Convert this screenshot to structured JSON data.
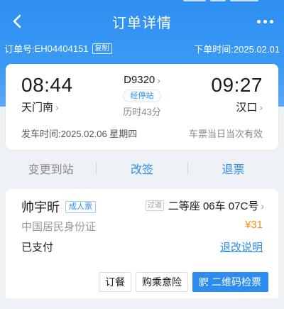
{
  "header": {
    "title": "订单详情",
    "back_icon": "chevron-left-icon",
    "more_icon": "more-dots-icon"
  },
  "order": {
    "order_no_label": "订单号:",
    "order_no": "EH04404151",
    "copy_label": "复制",
    "placed_time_label": "下单时间:",
    "placed_time": "2025.02.01"
  },
  "trip": {
    "depart_time": "08:44",
    "depart_station": "天门南",
    "train_no": "D9320",
    "via_label": "经停站",
    "duration": "历时43分",
    "arrive_time": "09:27",
    "arrive_station": "汉口",
    "depart_date_label": "发车时间:",
    "depart_date": "2025.02.06 星期四",
    "validity": "车票当日当次有效"
  },
  "actions": {
    "change_station": "变更到站",
    "rebook": "改签",
    "refund": "退票"
  },
  "passenger": {
    "name": "帅宇昕",
    "ticket_type": "成人票",
    "passed_tag": "过道",
    "seat": "二等座 06车 07C号",
    "id_type": "中国居民身份证",
    "price": "¥31",
    "pay_status": "已支付",
    "refund_note": "退改说明"
  },
  "bottom": {
    "order_meal": "订餐",
    "buy_insurance": "购乘意险",
    "qr_check": "二维码检票"
  },
  "colors": {
    "brand_blue": "#2d8cf0",
    "price_orange": "#ff8a00",
    "header_bg": "#3a99f5"
  }
}
